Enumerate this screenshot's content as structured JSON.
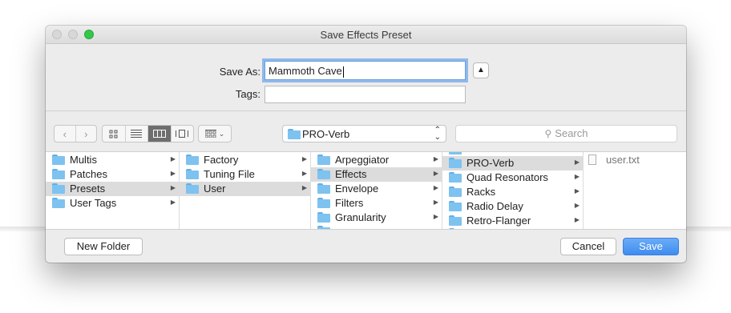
{
  "window": {
    "title": "Save Effects Preset"
  },
  "form": {
    "save_as_label": "Save As:",
    "save_as_value": "Mammoth Cave",
    "tags_label": "Tags:",
    "tags_value": ""
  },
  "toolbar": {
    "location": "PRO-Verb",
    "search_placeholder": "Search",
    "views": [
      "icon-view",
      "list-view",
      "column-view",
      "cover-flow-view"
    ],
    "active_view": "column-view"
  },
  "columns": [
    {
      "items": [
        {
          "label": "Multis",
          "folder": true,
          "arrow": true,
          "selected": false
        },
        {
          "label": "Patches",
          "folder": true,
          "arrow": true,
          "selected": false
        },
        {
          "label": "Presets",
          "folder": true,
          "arrow": true,
          "selected": true
        },
        {
          "label": "User Tags",
          "folder": true,
          "arrow": true,
          "selected": false
        }
      ]
    },
    {
      "items": [
        {
          "label": "Factory",
          "folder": true,
          "arrow": true,
          "selected": false
        },
        {
          "label": "Tuning File",
          "folder": true,
          "arrow": true,
          "selected": false
        },
        {
          "label": "User",
          "folder": true,
          "arrow": true,
          "selected": true
        }
      ]
    },
    {
      "items": [
        {
          "label": "Arpeggiator",
          "folder": true,
          "arrow": true,
          "selected": false
        },
        {
          "label": "Effects",
          "folder": true,
          "arrow": true,
          "selected": true
        },
        {
          "label": "Envelope",
          "folder": true,
          "arrow": true,
          "selected": false
        },
        {
          "label": "Filters",
          "folder": true,
          "arrow": true,
          "selected": false
        },
        {
          "label": "Granularity",
          "folder": true,
          "arrow": true,
          "selected": false
        }
      ]
    },
    {
      "items": [
        {
          "label": "PRO-Verb",
          "folder": true,
          "arrow": true,
          "selected": true
        },
        {
          "label": "Quad Resonators",
          "folder": true,
          "arrow": true,
          "selected": false
        },
        {
          "label": "Racks",
          "folder": true,
          "arrow": true,
          "selected": false
        },
        {
          "label": "Radio Delay",
          "folder": true,
          "arrow": true,
          "selected": false
        },
        {
          "label": "Retro-Flanger",
          "folder": true,
          "arrow": true,
          "selected": false
        }
      ]
    },
    {
      "items": [
        {
          "label": "user.txt",
          "folder": false,
          "arrow": false,
          "selected": false
        }
      ]
    }
  ],
  "buttons": {
    "new_folder": "New Folder",
    "cancel": "Cancel",
    "save": "Save"
  },
  "colors": {
    "accent": "#3f8cf0",
    "folder": "#7ec2f0",
    "selection": "#dcdcdc"
  }
}
